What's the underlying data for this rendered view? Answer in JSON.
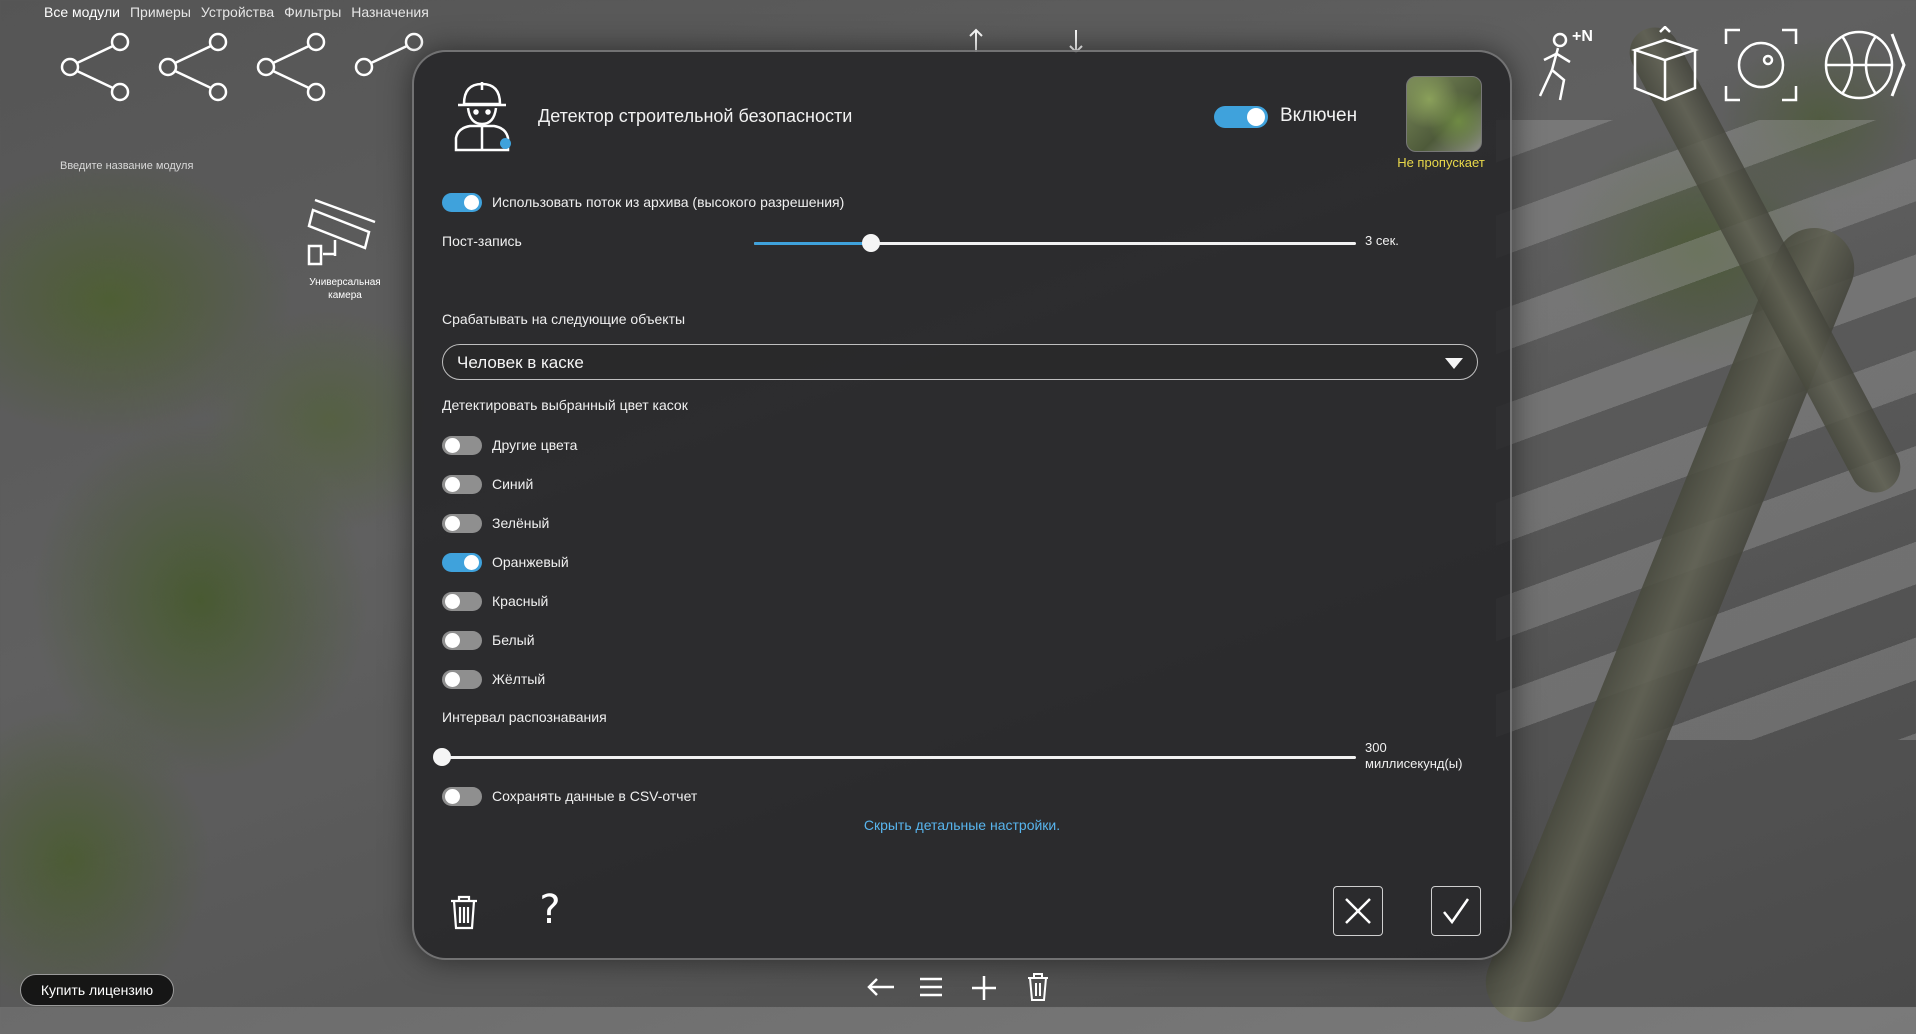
{
  "top_nav": {
    "items": [
      "Все модули",
      "Примеры",
      "Устройства",
      "Фильтры",
      "Назначения"
    ]
  },
  "workspace": {
    "module_name_placeholder": "Введите название модуля",
    "camera_node_label_line1": "Универсальная",
    "camera_node_label_line2": "камера",
    "toolbar_badge": "+N"
  },
  "modal": {
    "title": "Детектор строительной безопасности",
    "enabled_label": "Включен",
    "enabled": true,
    "status_label": "Не пропускает",
    "archive_stream_label": "Использовать поток из архива (высокого разрешения)",
    "archive_stream_on": true,
    "post_record_label": "Пост-запись",
    "post_record_value_text": "3 сек.",
    "post_record_fraction": 0.195,
    "objects_label": "Срабатывать на следующие объекты",
    "objects_selected": "Человек в каске",
    "colors_label": "Детектировать выбранный цвет касок",
    "colors": [
      {
        "label": "Другие цвета",
        "on": false
      },
      {
        "label": "Синий",
        "on": false
      },
      {
        "label": "Зелёный",
        "on": false
      },
      {
        "label": "Оранжевый",
        "on": true
      },
      {
        "label": "Красный",
        "on": false
      },
      {
        "label": "Белый",
        "on": false
      },
      {
        "label": "Жёлтый",
        "on": false
      }
    ],
    "interval_label": "Интервал распознавания",
    "interval_value_line1": "300",
    "interval_value_line2": "миллисекунд(ы)",
    "interval_fraction": 0.0,
    "csv_label": "Сохранять данные в CSV-отчет",
    "csv_on": false,
    "hide_details_link": "Скрыть детальные настройки.",
    "help_symbol": "?"
  },
  "footer": {
    "buy_license": "Купить лицензию"
  },
  "colors": {
    "accent": "#3fa2dc",
    "status_yellow": "#e8d84a",
    "link": "#58b5ee"
  }
}
